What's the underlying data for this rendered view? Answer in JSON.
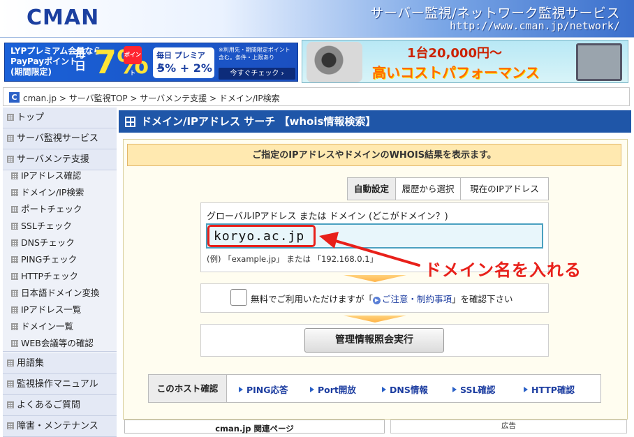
{
  "header": {
    "logo": "CMAN",
    "title": "サーバー監視/ネットワーク監視サービス",
    "url": "http://www.cman.jp/network/"
  },
  "ad_left": {
    "line1": "LYPプレミアム会員なら",
    "line2": "PayPayポイント",
    "line3": "(期間限定)",
    "every": "毎日",
    "percent": "7%",
    "pp_badge": "ポイント",
    "box_title": "毎日 プレミアム",
    "box_rate": "5% + 2%",
    "note": "※利用先・期間限定ポイント含む。条件・上限あり",
    "cta": "今すぐチェック ›"
  },
  "ad_right": {
    "line1": "1台20,000円～",
    "line2": "高いコストパフォーマンス"
  },
  "breadcrumb": {
    "icon": "C",
    "text": "cman.jp > サーバ監視TOP > サーバメンテ支援 > ドメイン/IP検索"
  },
  "sidebar": {
    "items": [
      {
        "label": "トップ",
        "level": "top"
      },
      {
        "label": "サーバ監視サービス",
        "level": "top"
      },
      {
        "label": "サーバメンテ支援",
        "level": "top"
      },
      {
        "label": "IPアドレス確認",
        "level": "sub"
      },
      {
        "label": "ドメイン/IP検索",
        "level": "sub"
      },
      {
        "label": "ポートチェック",
        "level": "sub"
      },
      {
        "label": "SSLチェック",
        "level": "sub"
      },
      {
        "label": "DNSチェック",
        "level": "sub"
      },
      {
        "label": "PINGチェック",
        "level": "sub"
      },
      {
        "label": "HTTPチェック",
        "level": "sub"
      },
      {
        "label": "日本語ドメイン変換",
        "level": "sub"
      },
      {
        "label": "IPアドレス一覧",
        "level": "sub"
      },
      {
        "label": "ドメイン一覧",
        "level": "sub"
      },
      {
        "label": "WEB会議等の確認",
        "level": "sub"
      },
      {
        "label": "用語集",
        "level": "top"
      },
      {
        "label": "監視操作マニュアル",
        "level": "top"
      },
      {
        "label": "よくあるご質問",
        "level": "top"
      },
      {
        "label": "障害・メンテナンス",
        "level": "top"
      }
    ]
  },
  "main": {
    "title": "ドメイン/IPアドレス サーチ 【whois情報検索】",
    "notice": "ご指定のIPアドレスやドメインのWHOIS結果を表示ます。",
    "tabs": [
      "自動設定",
      "履歴から選択",
      "現在のIPアドレス"
    ],
    "input_label": "グローバルIPアドレス または ドメイン (どこがドメイン？)",
    "input_value": "koryo.ac.jp",
    "input_example": "(例) 「example.jp」 または 「192.168.0.1」",
    "annotation": "ドメイン名を入れる",
    "agree_text_before": "無料でご利用いただけますが「",
    "agree_link": "ご注意・制約事項",
    "agree_text_after": "」を確認下さい",
    "submit": "管理情報照会実行",
    "host_check_label": "このホスト確認",
    "host_links": [
      "PING応答",
      "Port開放",
      "DNS情報",
      "SSL確認",
      "HTTP確認"
    ],
    "related_header": "cman.jp 関連ページ",
    "ad_header": "広告"
  },
  "colors": {
    "title_bar": "#1f56a8",
    "annotation_red": "#e8201a",
    "input_border": "#4aa0c0",
    "notice_bg": "#ffe9b0"
  }
}
